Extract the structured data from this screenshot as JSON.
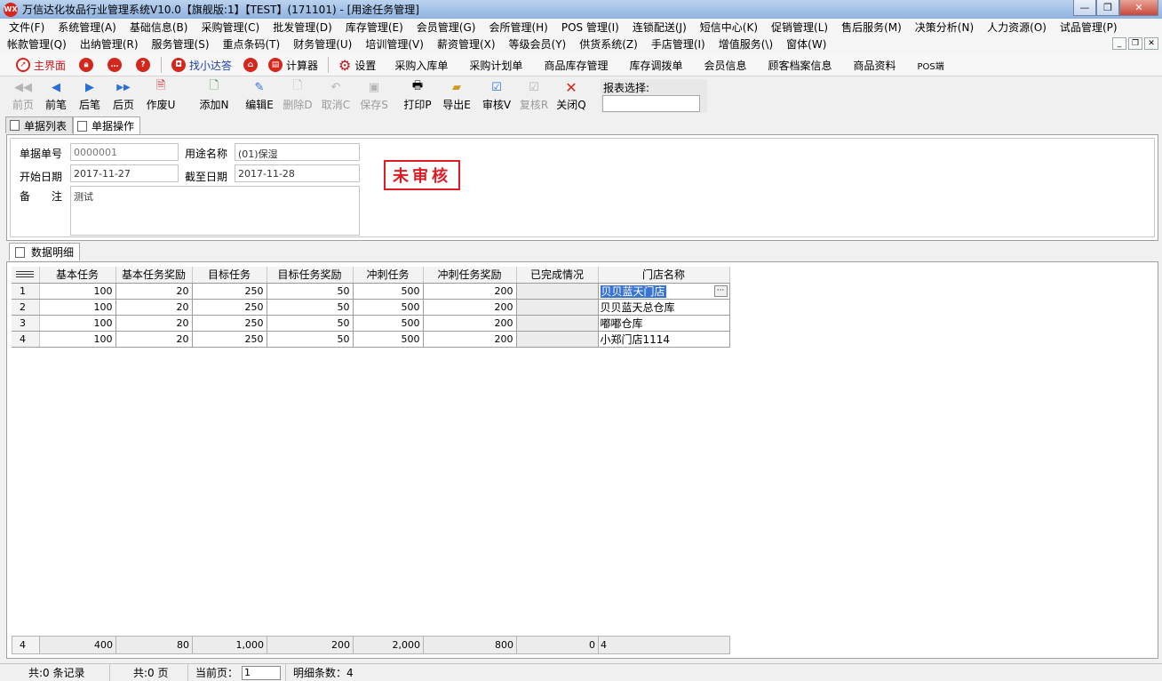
{
  "window": {
    "title": "万信达化妆品行业管理系统V10.0【旗舰版:1】【TEST】(171101) - [用途任务管理]",
    "min": "—",
    "restore": "❐",
    "close": "✕"
  },
  "menu": {
    "row1": [
      "文件(F)",
      "系统管理(A)",
      "基础信息(B)",
      "采购管理(C)",
      "批发管理(D)",
      "库存管理(E)",
      "会员管理(G)",
      "会所管理(H)",
      "POS 管理(I)",
      "连锁配送(J)",
      "短信中心(K)",
      "促销管理(L)",
      "售后服务(M)",
      "决策分析(N)",
      "人力资源(O)",
      "试品管理(P)"
    ],
    "row2": [
      "帐款管理(Q)",
      "出纳管理(R)",
      "服务管理(S)",
      "重点条码(T)",
      "财务管理(U)",
      "培训管理(V)",
      "薪资管理(X)",
      "等级会员(Y)",
      "供货系统(Z)",
      "手店管理(I)",
      "增值服务(\\)",
      "窗体(W)"
    ]
  },
  "quickbar": {
    "home": "主界面",
    "find": "找小达答",
    "calculator": "计算器",
    "settings": "设置",
    "links": [
      "采购入库单",
      "采购计划单",
      "商品库存管理",
      "库存调拨单",
      "会员信息",
      "顾客档案信息",
      "商品资料",
      "POS端"
    ]
  },
  "toolbar": {
    "first": "前页",
    "prev": "前笔",
    "next": "后笔",
    "last": "后页",
    "void": "作废U",
    "add": "添加N",
    "edit": "编辑E",
    "delete": "删除D",
    "cancel": "取消C",
    "save": "保存S",
    "print": "打印P",
    "export": "导出E",
    "approve": "审核V",
    "reapprove": "复核R",
    "close": "关闭Q",
    "report_label": "报表选择:"
  },
  "tabs": {
    "list": "单据列表",
    "operate": "单据操作"
  },
  "form": {
    "doc_no_label": "单据单号",
    "doc_no": "0000001",
    "purpose_label": "用途名称",
    "purpose": "(01)保湿",
    "start_label": "开始日期",
    "start": "2017-11-27",
    "end_label": "截至日期",
    "end": "2017-11-28",
    "remark_label": "备　注",
    "remark": "测试",
    "stamp": "未审核"
  },
  "detail": {
    "tab": "数据明细",
    "columns": [
      "基本任务",
      "基本任务奖励",
      "目标任务",
      "目标任务奖励",
      "冲刺任务",
      "冲刺任务奖励",
      "已完成情况",
      "门店名称"
    ],
    "rows": [
      {
        "n": "1",
        "c": [
          "100",
          "20",
          "250",
          "50",
          "500",
          "200",
          "",
          "贝贝蓝天门店"
        ]
      },
      {
        "n": "2",
        "c": [
          "100",
          "20",
          "250",
          "50",
          "500",
          "200",
          "",
          "贝贝蓝天总仓库"
        ]
      },
      {
        "n": "3",
        "c": [
          "100",
          "20",
          "250",
          "50",
          "500",
          "200",
          "",
          "嘟嘟仓库"
        ]
      },
      {
        "n": "4",
        "c": [
          "100",
          "20",
          "250",
          "50",
          "500",
          "200",
          "",
          "小郑门店1114"
        ]
      }
    ],
    "summary": [
      "4",
      "400",
      "80",
      "1,000",
      "200",
      "2,000",
      "800",
      "0",
      "4"
    ]
  },
  "status": {
    "records": "共:0 条记录",
    "pages": "共:0 页",
    "current_label": "当前页：",
    "current": "1",
    "detail_count": "明细条数：4"
  }
}
